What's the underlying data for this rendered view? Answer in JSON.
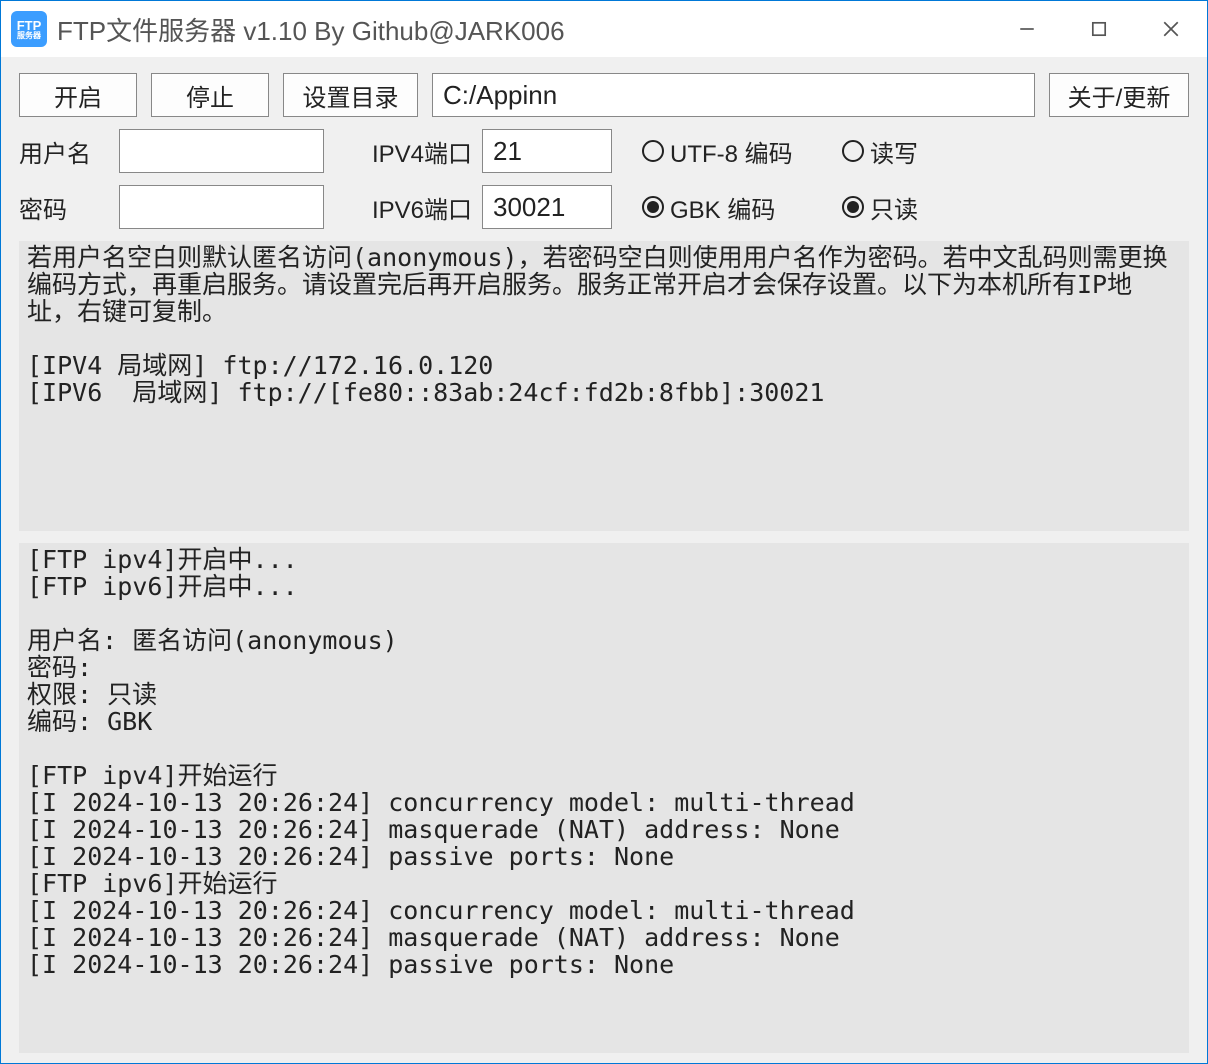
{
  "title": "FTP文件服务器 v1.10 By Github@JARK006",
  "appIcon": {
    "line1": "FTP",
    "line2": "服务器"
  },
  "toolbar": {
    "start": "开启",
    "stop": "停止",
    "setDir": "设置目录",
    "about": "关于/更新"
  },
  "path": "C:/Appinn",
  "labels": {
    "username": "用户名",
    "password": "密码",
    "ipv4port": "IPV4端口",
    "ipv6port": "IPV6端口"
  },
  "inputs": {
    "username": "",
    "password": "",
    "ipv4port": "21",
    "ipv6port": "30021"
  },
  "radios": {
    "utf8": "UTF-8 编码",
    "gbk": "GBK 编码",
    "readwrite": "读写",
    "readonly": "只读",
    "encodingSelected": "gbk",
    "permissionSelected": "readonly"
  },
  "log1": "若用户名空白则默认匿名访问(anonymous)，若密码空白则使用用户名作为密码。若中文乱码则需更换编码方式，再重启服务。请设置完后再开启服务。服务正常开启才会保存设置。以下为本机所有IP地址，右键可复制。\n\n[IPV4 局域网] ftp://172.16.0.120\n[IPV6  局域网] ftp://[fe80::83ab:24cf:fd2b:8fbb]:30021",
  "log2": "[FTP ipv4]开启中...\n[FTP ipv6]开启中...\n\n用户名: 匿名访问(anonymous)\n密码:\n权限: 只读\n编码: GBK\n\n[FTP ipv4]开始运行\n[I 2024-10-13 20:26:24] concurrency model: multi-thread\n[I 2024-10-13 20:26:24] masquerade (NAT) address: None\n[I 2024-10-13 20:26:24] passive ports: None\n[FTP ipv6]开始运行\n[I 2024-10-13 20:26:24] concurrency model: multi-thread\n[I 2024-10-13 20:26:24] masquerade (NAT) address: None\n[I 2024-10-13 20:26:24] passive ports: None"
}
